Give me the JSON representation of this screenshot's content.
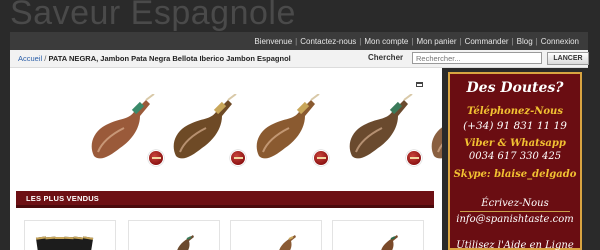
{
  "header": {
    "logo": "Saveur Espagnole"
  },
  "topnav": {
    "items": [
      "Bienvenue",
      "Contactez-nous",
      "Mon compte",
      "Mon panier",
      "Commander",
      "Blog",
      "Connexion"
    ],
    "separator": "|"
  },
  "breadcrumb": {
    "home": "Accueil",
    "separator": "/",
    "current": "PATA NEGRA, Jambon Pata Negra Bellota Iberico Jambon Espagnol"
  },
  "search": {
    "label": "Chercher",
    "placeholder": "Rechercher...",
    "button": "LANCER"
  },
  "featured": {
    "item_count": 5
  },
  "bestsellers": {
    "title": "LES PLUS VENDUS"
  },
  "sidebar": {
    "title": "Des Doutes?",
    "phone_label": "Téléphonez-Nous",
    "phone": "(+34) 91 831 11 19",
    "viber_label": "Viber & Whatsapp",
    "viber_number": "0034 617 330 425",
    "skype": "Skype: blaise_delgado",
    "email_label": "Écrivez-Nous",
    "email": "info@spanishtaste.com",
    "help": "Utilisez l'Aide en Ligne"
  },
  "colors": {
    "brand_red": "#6a0d12",
    "accent_gold": "#f2c232",
    "nav_bg": "#3b3b3b"
  }
}
